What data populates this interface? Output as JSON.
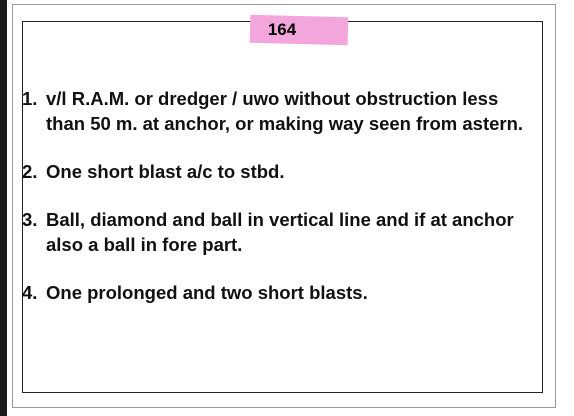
{
  "page_number": "164",
  "answers": [
    {
      "number": "1.",
      "text": "v/l R.A.M. or dredger / uwo without obstruction less than 50 m. at anchor, or making way seen from astern."
    },
    {
      "number": "2.",
      "text": "One short blast a/c to stbd."
    },
    {
      "number": "3.",
      "text": "Ball, diamond and ball in vertical line and if at anchor also a ball in fore part."
    },
    {
      "number": "4.",
      "text": "One prolonged and two short blasts."
    }
  ],
  "colors": {
    "highlight": "#f3a6dc",
    "text": "#111111",
    "border": "#222222"
  }
}
